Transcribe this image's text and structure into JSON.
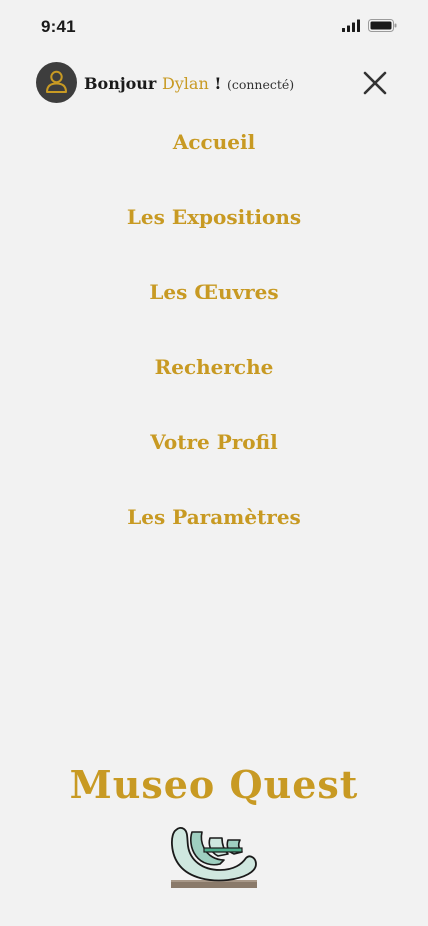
{
  "status_bar": {
    "time": "9:41",
    "signal_icon": "cellular-signal-icon",
    "battery_icon": "battery-icon"
  },
  "header": {
    "avatar_icon": "user-avatar-icon",
    "greeting_prefix": "Bonjour",
    "user_name": "Dylan",
    "exclamation": "!",
    "status": "(connecté)",
    "close_icon": "close-icon"
  },
  "menu": {
    "items": [
      {
        "label": "Accueil"
      },
      {
        "label": "Les Expositions"
      },
      {
        "label": "Les Œuvres"
      },
      {
        "label": "Recherche"
      },
      {
        "label": "Votre Profil"
      },
      {
        "label": "Les Paramètres"
      }
    ]
  },
  "footer": {
    "brand": "Museo Quest",
    "logo_icon": "sculpture-logo-icon"
  },
  "colors": {
    "accent": "#c89a23",
    "background": "#f2f2f2",
    "text_dark": "#1a1a1a",
    "avatar_bg": "#3d3d3d"
  }
}
